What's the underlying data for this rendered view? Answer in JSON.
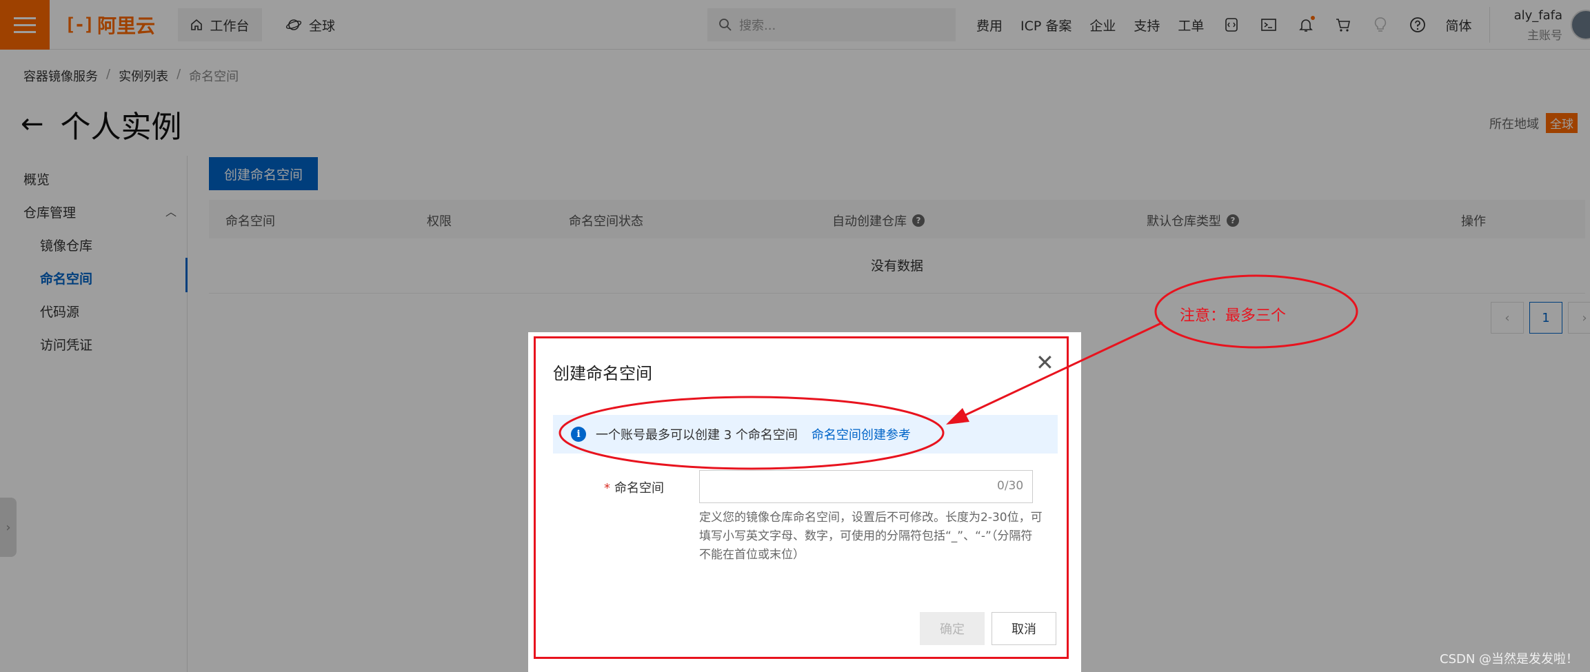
{
  "topbar": {
    "logo_text": "阿里云",
    "workbench_label": "工作台",
    "global_label": "全球",
    "search_placeholder": "搜索...",
    "links": [
      "费用",
      "ICP 备案",
      "企业",
      "支持",
      "工单"
    ],
    "lang_label": "简体",
    "user_name": "aly_fafa",
    "user_role": "主账号"
  },
  "breadcrumb": [
    "容器镜像服务",
    "实例列表",
    "命名空间"
  ],
  "page": {
    "title": "个人实例",
    "region_label": "所在地域",
    "region_value": "全球"
  },
  "sidebar": {
    "overview": "概览",
    "repo_management": "仓库管理",
    "items": [
      "镜像仓库",
      "命名空间",
      "代码源",
      "访问凭证"
    ]
  },
  "main": {
    "create_button": "创建命名空间",
    "columns": [
      "命名空间",
      "权限",
      "命名空间状态",
      "自动创建仓库",
      "默认仓库类型",
      "操作"
    ],
    "empty_text": "没有数据",
    "current_page": "1"
  },
  "modal": {
    "title": "创建命名空间",
    "notice_text": "一个账号最多可以创建 3 个命名空间",
    "notice_link": "命名空间创建参考",
    "field_label": "命名空间",
    "field_value": "",
    "field_counter": "0/30",
    "field_help": "定义您的镜像仓库命名空间，设置后不可修改。长度为2-30位，可填写小写英文字母、数字，可使用的分隔符包括“_”、“-”（分隔符不能在首位或末位）",
    "ok_label": "确定",
    "cancel_label": "取消"
  },
  "annotation": {
    "note": "注意：最多三个"
  },
  "watermark": "CSDN @当然是发发啦！",
  "colors": {
    "brand": "#ff6a00",
    "primary": "#0064c8",
    "annotation_red": "#e8131e"
  }
}
